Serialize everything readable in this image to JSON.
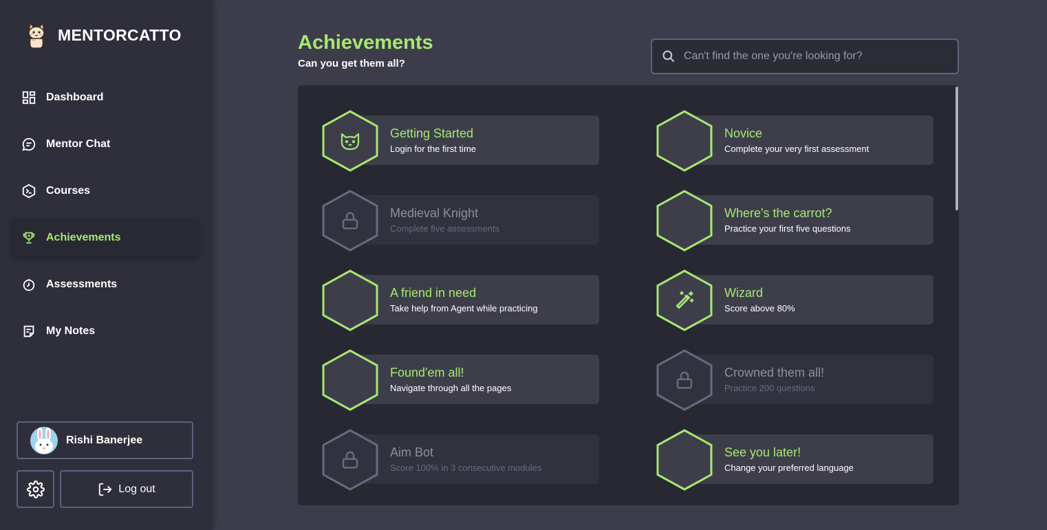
{
  "app": {
    "name": "MENTORCATTO"
  },
  "sidebar": {
    "items": [
      {
        "label": "Dashboard",
        "icon": "dashboard-icon"
      },
      {
        "label": "Mentor Chat",
        "icon": "chat-icon"
      },
      {
        "label": "Courses",
        "icon": "terminal-hex-icon"
      },
      {
        "label": "Achievements",
        "icon": "trophy-icon",
        "active": true
      },
      {
        "label": "Assessments",
        "icon": "timer-icon"
      },
      {
        "label": "My Notes",
        "icon": "note-icon"
      }
    ],
    "user": {
      "name": "Rishi Banerjee"
    },
    "logout_label": "Log out"
  },
  "page": {
    "title": "Achievements",
    "subtitle": "Can you get them all?"
  },
  "search": {
    "placeholder": "Can't find the one you're looking for?"
  },
  "achievements": [
    {
      "title": "Getting Started",
      "desc": "Login for the first time",
      "locked": false,
      "icon": "cat-face-icon"
    },
    {
      "title": "Novice",
      "desc": "Complete your very first assessment",
      "locked": false,
      "icon": ""
    },
    {
      "title": "Medieval Knight",
      "desc": "Complete five assessments",
      "locked": true,
      "icon": "lock-icon"
    },
    {
      "title": "Where's the carrot?",
      "desc": "Practice your first five questions",
      "locked": false,
      "icon": ""
    },
    {
      "title": "A friend in need",
      "desc": "Take help from Agent while practicing",
      "locked": false,
      "icon": ""
    },
    {
      "title": "Wizard",
      "desc": "Score above 80%",
      "locked": false,
      "icon": "magic-wand-icon"
    },
    {
      "title": "Found'em all!",
      "desc": "Navigate through all the pages",
      "locked": false,
      "icon": ""
    },
    {
      "title": "Crowned them all!",
      "desc": "Practice 200 questions",
      "locked": true,
      "icon": "lock-icon"
    },
    {
      "title": "Aim Bot",
      "desc": "Score 100% in 3 consecutive modules",
      "locked": true,
      "icon": "lock-icon"
    },
    {
      "title": "See you later!",
      "desc": "Change your preferred language",
      "locked": false,
      "icon": ""
    }
  ],
  "colors": {
    "accent": "#a6e870",
    "background": "#3c3c4a",
    "sidebar": "#2f2f3b",
    "panel": "#282833",
    "card": "#3e3e4b",
    "locked": "#666a82",
    "border": "#5c6380"
  }
}
